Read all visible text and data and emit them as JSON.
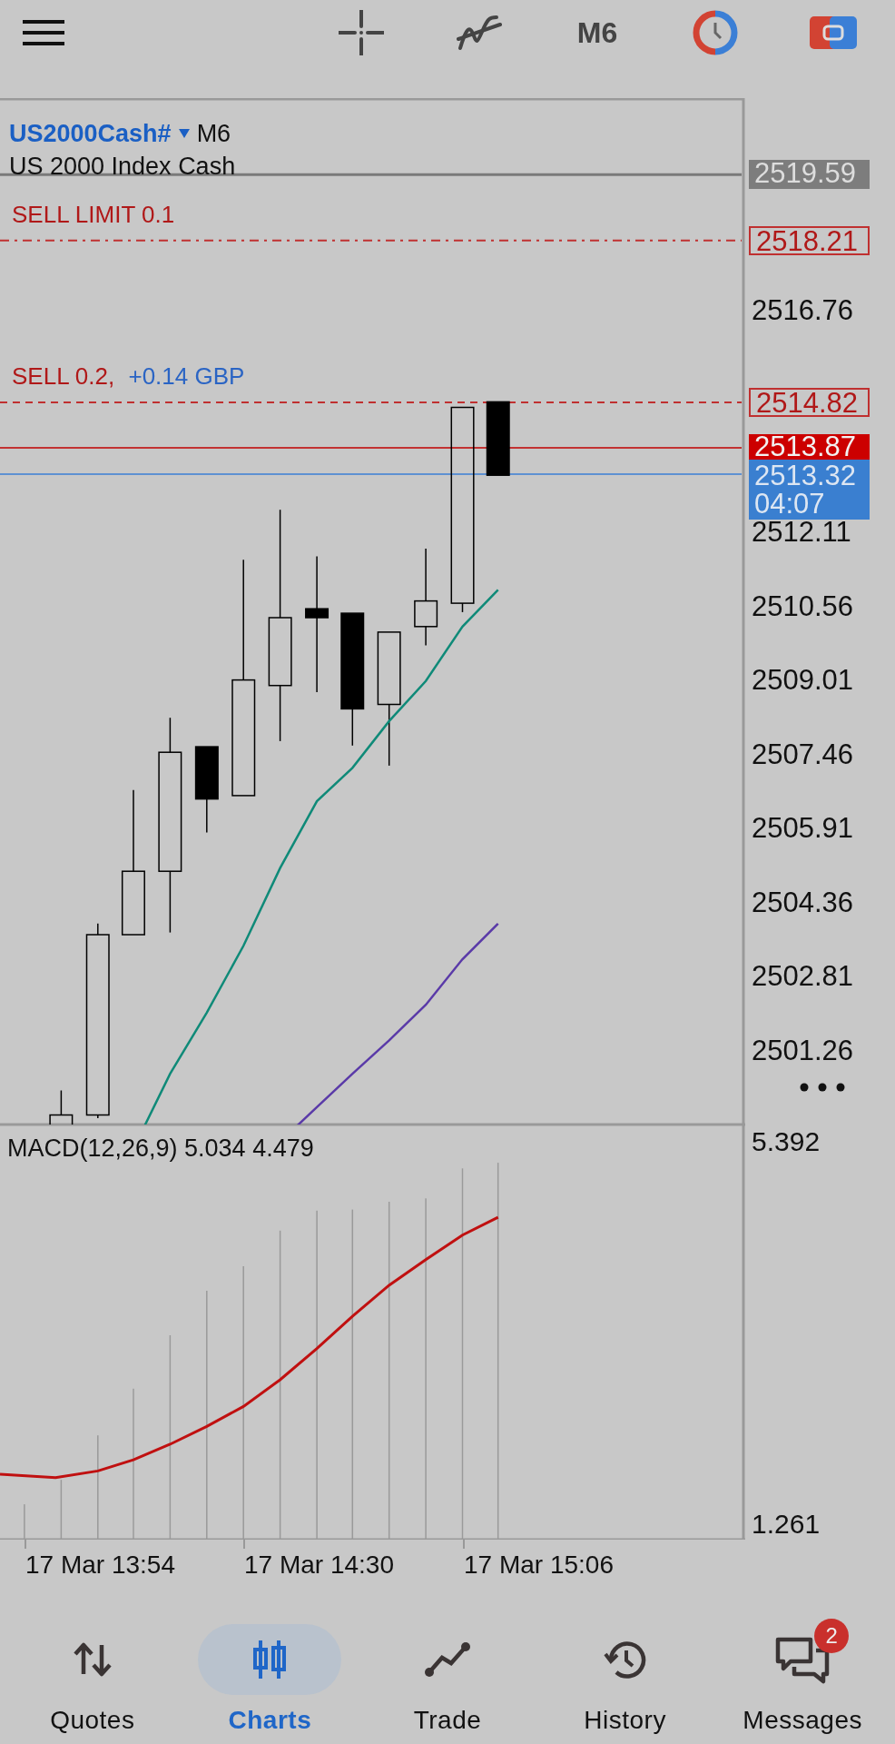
{
  "toolbar": {
    "timeframe": "M6"
  },
  "chart": {
    "symbol": "US2000Cash#",
    "timeframe": "M6",
    "description": "US 2000 Index Cash",
    "markers": [
      {
        "kind": "high",
        "price": "2519.59"
      },
      {
        "kind": "bid",
        "price": "2513.87"
      },
      {
        "kind": "ask",
        "price": "2513.32",
        "countdown": "04:07"
      }
    ],
    "orders": [
      {
        "kind": "limit",
        "label": "SELL LIMIT 0.1",
        "price": "2518.21"
      },
      {
        "kind": "position",
        "label": "SELL 0.2,",
        "profit": "+0.14 GBP",
        "price": "2514.82"
      }
    ],
    "price_labels": [
      "2516.76",
      "2512.11",
      "2510.56",
      "2509.01",
      "2507.46",
      "2505.91",
      "2504.36",
      "2502.81",
      "2501.26"
    ],
    "indicator": {
      "label": "MACD(12,26,9) 5.034 4.479",
      "max": "5.392",
      "min": "1.261"
    },
    "time_labels": [
      "17 Mar 13:54",
      "17 Mar 14:30",
      "17 Mar 15:06"
    ]
  },
  "nav": [
    {
      "label": "Quotes",
      "selected": false
    },
    {
      "label": "Charts",
      "selected": true
    },
    {
      "label": "Trade",
      "selected": false
    },
    {
      "label": "History",
      "selected": false
    },
    {
      "label": "Messages",
      "selected": false,
      "badge": "2"
    }
  ]
}
